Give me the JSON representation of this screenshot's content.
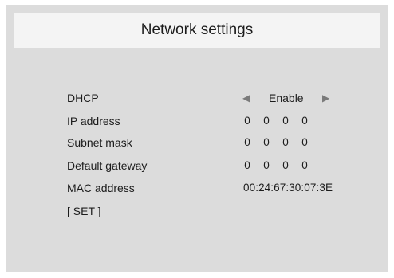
{
  "header": {
    "title": "Network settings"
  },
  "rows": {
    "dhcp": {
      "label": "DHCP",
      "value": "Enable",
      "left_arrow": "◀",
      "right_arrow": "▶"
    },
    "ip": {
      "label": "IP address",
      "octets": [
        "0",
        "0",
        "0",
        "0"
      ]
    },
    "subnet": {
      "label": "Subnet mask",
      "octets": [
        "0",
        "0",
        "0",
        "0"
      ]
    },
    "gateway": {
      "label": "Default gateway",
      "octets": [
        "0",
        "0",
        "0",
        "0"
      ]
    },
    "mac": {
      "label": "MAC address",
      "value": "00:24:67:30:07:3E"
    },
    "set": {
      "label": "[ SET ]"
    }
  }
}
